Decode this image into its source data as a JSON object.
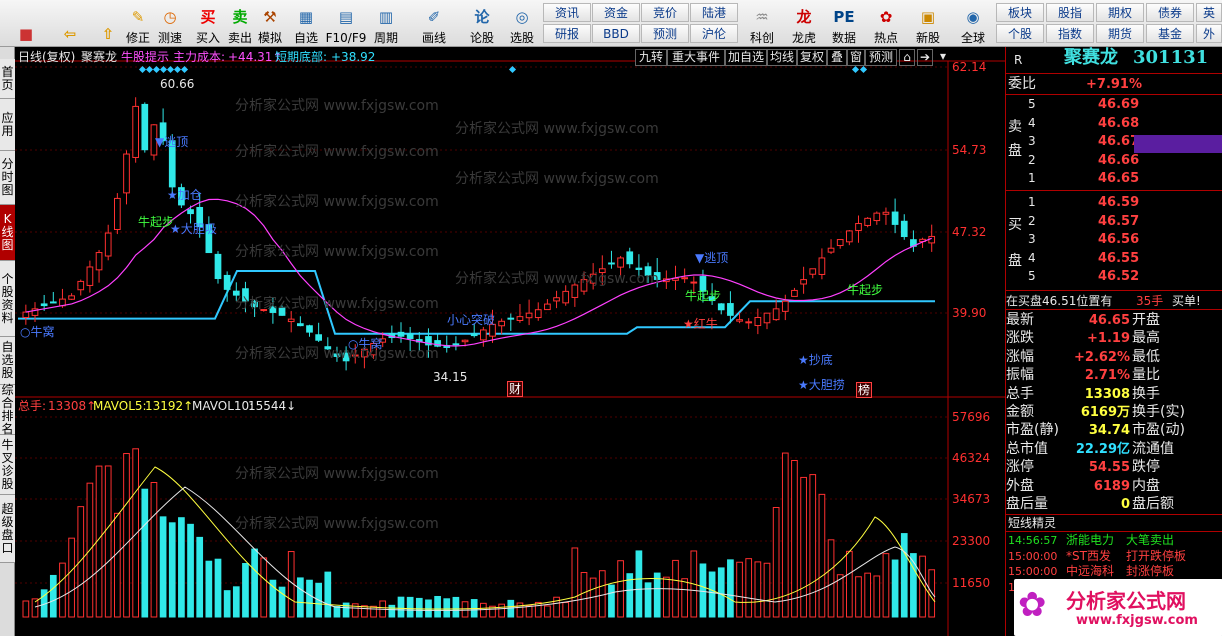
{
  "toolbar": {
    "buttons": [
      {
        "label": "",
        "icon": "■",
        "name": "grid-icon",
        "color": "#c33"
      },
      {
        "label": "",
        "icon": "⇦",
        "name": "back-arrow-icon",
        "color": "#d90"
      },
      {
        "label": "",
        "icon": "⇧",
        "name": "up-arrow-icon",
        "color": "#d90"
      },
      {
        "label": "修正",
        "icon": "✎",
        "name": "edit-icon",
        "color": "#d90"
      },
      {
        "label": "测速",
        "icon": "◷",
        "name": "speedometer-icon",
        "color": "#d60"
      },
      {
        "label": "买入",
        "icon": "买",
        "name": "buy-icon",
        "color": "#e00"
      },
      {
        "label": "卖出",
        "icon": "卖",
        "name": "sell-icon",
        "color": "#0a0"
      },
      {
        "label": "模拟",
        "icon": "⚒",
        "name": "hammer-icon",
        "color": "#a40"
      },
      {
        "label": "自选",
        "icon": "▦",
        "name": "watchlist-icon",
        "color": "#26a"
      },
      {
        "label": "F10/F9",
        "icon": "▤",
        "name": "f10-icon",
        "color": "#26a"
      },
      {
        "label": "周期",
        "icon": "▥",
        "name": "period-icon",
        "color": "#26a"
      },
      {
        "label": "画线",
        "icon": "✐",
        "name": "pen-icon",
        "color": "#26a"
      },
      {
        "label": "论股",
        "icon": "论",
        "name": "discuss-icon",
        "color": "#26a"
      },
      {
        "label": "选股",
        "icon": "◎",
        "name": "stock-picker-icon",
        "color": "#26a"
      },
      {
        "label": "科创",
        "icon": "♒",
        "name": "chart-line-icon",
        "color": "#888"
      },
      {
        "label": "龙虎",
        "icon": "龙",
        "name": "dragon-icon",
        "color": "#c00"
      },
      {
        "label": "数据",
        "icon": "PE",
        "name": "pe-icon",
        "color": "#048"
      },
      {
        "label": "热点",
        "icon": "✿",
        "name": "hotspot-icon",
        "color": "#c00"
      },
      {
        "label": "新股",
        "icon": "▣",
        "name": "new-stock-icon",
        "color": "#c80"
      },
      {
        "label": "全球",
        "icon": "◉",
        "name": "globe-icon",
        "color": "#26a"
      }
    ],
    "grid_row1": [
      "资讯",
      "资金",
      "竞价",
      "陆港"
    ],
    "grid_row2": [
      "研报",
      "BBD",
      "预测",
      "沪伦"
    ],
    "grid2_row1": [
      "板块",
      "股指",
      "期权",
      "债券",
      "英"
    ],
    "grid2_row2": [
      "个股",
      "指数",
      "期货",
      "基金",
      "外"
    ]
  },
  "leftnav": [
    "首页",
    "应用",
    "分时图",
    "K线图",
    "个股资料",
    "自选股",
    "综合排名",
    "牛叉诊股",
    "超级盘口"
  ],
  "chart": {
    "title": "日线(复权)",
    "stock_name": "聚赛龙",
    "indicator": "牛股提示",
    "cost_label": "主力成本:",
    "cost_value": "+44.31↑",
    "bottom_label": "短期底部:",
    "bottom_value": "+38.92",
    "tabs": [
      "九转",
      "重大事件",
      "加自选",
      "均线",
      "复权",
      "叠",
      "窗",
      "预测"
    ],
    "price_axis": [
      "62.14",
      "54.73",
      "47.32",
      "39.90"
    ],
    "vol_axis": [
      "57696",
      "46324",
      "34673",
      "23300",
      "11650"
    ],
    "vol_label": "总手:",
    "vol_value": "13308↑",
    "mavol5_label": "MAVOL5:",
    "mavol5_value": "13192↑",
    "mavol10_label": "MAVOL10:",
    "mavol10_value": "15544↓",
    "high_label": "60.66",
    "low_label": "34.15",
    "watermark": "分析家公式网 www.fxjgsw.com",
    "signals": [
      "★加仓",
      "牛起步",
      "★大胆吸",
      "▼逃顶",
      "○牛窝",
      "○牛窝",
      "小心突破",
      "财",
      "▼逃顶",
      "牛起步",
      "★红牛",
      "牛起步",
      "★抄底",
      "★大胆捞",
      "榜"
    ]
  },
  "quote": {
    "label": "R",
    "name": "聚赛龙",
    "code": "301131",
    "weibi_label": "委比",
    "weibi": "+7.91%",
    "sell_label": [
      "卖",
      "盘"
    ],
    "buy_label": [
      "买",
      "盘"
    ],
    "sell": [
      {
        "n": "5",
        "p": "46.69"
      },
      {
        "n": "4",
        "p": "46.68"
      },
      {
        "n": "3",
        "p": "46.67"
      },
      {
        "n": "2",
        "p": "46.66"
      },
      {
        "n": "1",
        "p": "46.65"
      }
    ],
    "buy": [
      {
        "n": "1",
        "p": "46.59"
      },
      {
        "n": "2",
        "p": "46.57"
      },
      {
        "n": "3",
        "p": "46.56"
      },
      {
        "n": "4",
        "p": "46.55"
      },
      {
        "n": "5",
        "p": "46.52"
      }
    ],
    "zaimai": "在买盘46.51位置有",
    "zaimai_v": "35手",
    "zaimai_act": "买单!",
    "stats": [
      [
        "最新",
        "46.65",
        "开盘"
      ],
      [
        "涨跌",
        "+1.19",
        "最高"
      ],
      [
        "涨幅",
        "+2.62%",
        "最低"
      ],
      [
        "振幅",
        "2.71%",
        "量比"
      ],
      [
        "总手",
        "13308",
        "换手"
      ],
      [
        "金额",
        "6169万",
        "换手(实)"
      ],
      [
        "市盈(静)",
        "34.74",
        "市盈(动)"
      ],
      [
        "总市值",
        "22.29亿",
        "流通值"
      ],
      [
        "涨停",
        "54.55",
        "跌停"
      ],
      [
        "外盘",
        "6189",
        "内盘"
      ],
      [
        "盘后量",
        "0",
        "盘后额"
      ]
    ],
    "flash_title": "短线精灵",
    "flash": [
      [
        "14:56:57",
        "浙能电力",
        "大笔卖出"
      ],
      [
        "15:00:00",
        "*ST西发",
        "打开跌停板"
      ],
      [
        "15:00:00",
        "中远海科",
        "封涨停板"
      ],
      [
        "15:00:00",
        "",
        ""
      ]
    ],
    "logo": "分析家公式网",
    "logo_url": "www.fxjgsw.com"
  },
  "chart_data": {
    "type": "candlestick",
    "price_ylim": [
      34.15,
      62.14
    ],
    "volume_ylim": [
      0,
      57696
    ],
    "price_ticks": [
      62.14,
      54.73,
      47.32,
      39.9
    ],
    "volume_ticks": [
      57696,
      46324,
      34673,
      23300,
      11650
    ],
    "last_close": 46.65,
    "cost": 44.31,
    "short_bottom": 38.92,
    "high_marker": 60.66,
    "low_marker": 34.15
  }
}
